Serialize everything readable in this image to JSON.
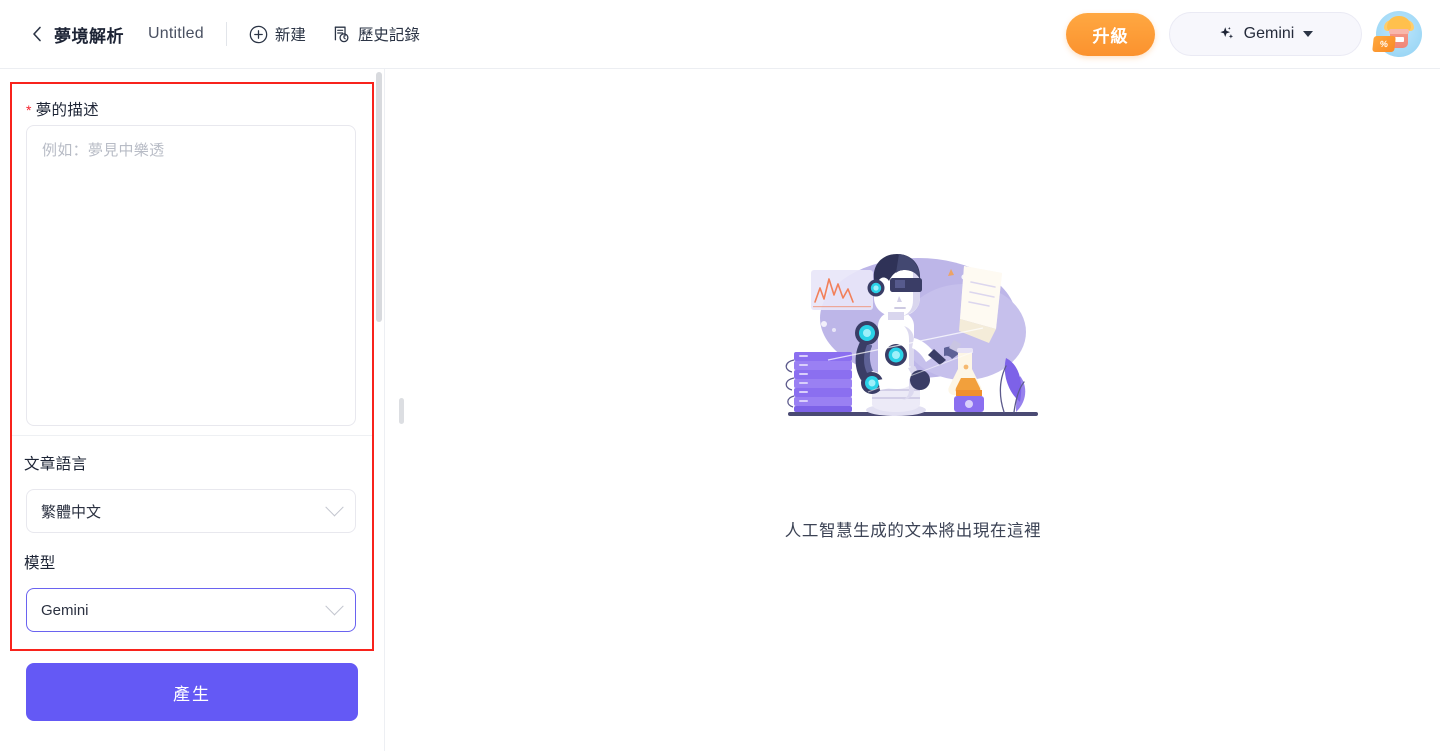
{
  "header": {
    "back_icon": "chevron-left-icon",
    "app_title": "夢境解析",
    "doc_title": "Untitled",
    "actions": [
      {
        "icon": "plus-circle-icon",
        "label": "新建"
      },
      {
        "icon": "history-clock-icon",
        "label": "歷史記錄"
      }
    ],
    "upgrade_label": "升級",
    "model_button": {
      "icon": "sparkle-icon",
      "label": "Gemini",
      "caret": "chevron-down-icon"
    },
    "avatar": {
      "name": "user-avatar",
      "badge_label": "%"
    }
  },
  "left_panel": {
    "description": {
      "required_mark": "*",
      "label": "夢的描述",
      "value": "",
      "placeholder": "例如：夢見中樂透"
    },
    "language": {
      "label": "文章語言",
      "value": "繁體中文"
    },
    "model": {
      "label": "模型",
      "value": "Gemini"
    },
    "generate_label": "產生"
  },
  "main": {
    "illustration": "robot-reading-illustration",
    "empty_text": "人工智慧生成的文本將出現在這裡"
  },
  "colors": {
    "accent_purple": "#6459f5",
    "upgrade_orange": "#fb922e",
    "highlight_red": "#f8231c",
    "focus_border": "#6a63f0"
  }
}
